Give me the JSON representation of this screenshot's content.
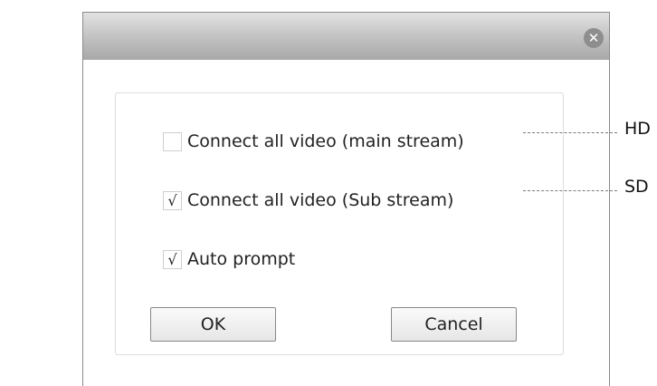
{
  "dialog": {
    "close_symbol": "✕",
    "close_icon": "close-circle-icon",
    "options": [
      {
        "label": "Connect all video (main stream)",
        "checked": false,
        "mark": ""
      },
      {
        "label": "Connect all video (Sub stream)",
        "checked": true,
        "mark": "√"
      },
      {
        "label": "Auto prompt",
        "checked": true,
        "mark": "√"
      }
    ],
    "ok_label": "OK",
    "cancel_label": "Cancel"
  },
  "annotations": {
    "hd": "HD",
    "sd": "SD"
  }
}
